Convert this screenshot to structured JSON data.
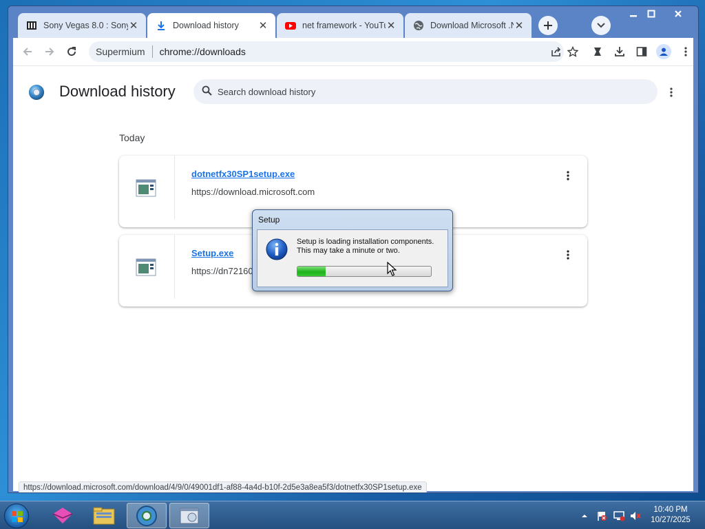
{
  "browser": {
    "tabs": [
      {
        "title": "Sony Vegas 8.0 : Sony",
        "icon": "archive-icon",
        "active": false
      },
      {
        "title": "Download history",
        "icon": "download-icon",
        "active": true
      },
      {
        "title": "net framework - YouTu",
        "icon": "youtube-icon",
        "active": false
      },
      {
        "title": "Download Microsoft .N",
        "icon": "globe-icon",
        "active": false
      }
    ],
    "omnibox": {
      "site": "Supermium",
      "url": "chrome://downloads"
    }
  },
  "downloads_page": {
    "title": "Download history",
    "search_placeholder": "Search download history",
    "section_label": "Today",
    "items": [
      {
        "filename": "dotnetfx30SP1setup.exe",
        "url": "https://download.microsoft.com"
      },
      {
        "filename": "Setup.exe",
        "url": "https://dn72160"
      }
    ],
    "status_url": "https://download.microsoft.com/download/4/9/0/49001df1-af88-4a4d-b10f-2d5e3a8ea5f3/dotnetfx30SP1setup.exe"
  },
  "setup_dialog": {
    "title": "Setup",
    "message_line1": "Setup is loading installation components.",
    "message_line2": "This may take a minute or two.",
    "progress_fraction": 0.21,
    "progress_color": "#1fb31c"
  },
  "taskbar": {
    "time": "10:40 PM",
    "date": "10/27/2025"
  },
  "colors": {
    "accent": "#1a73e8",
    "tabstrip": "#5b84c6"
  }
}
